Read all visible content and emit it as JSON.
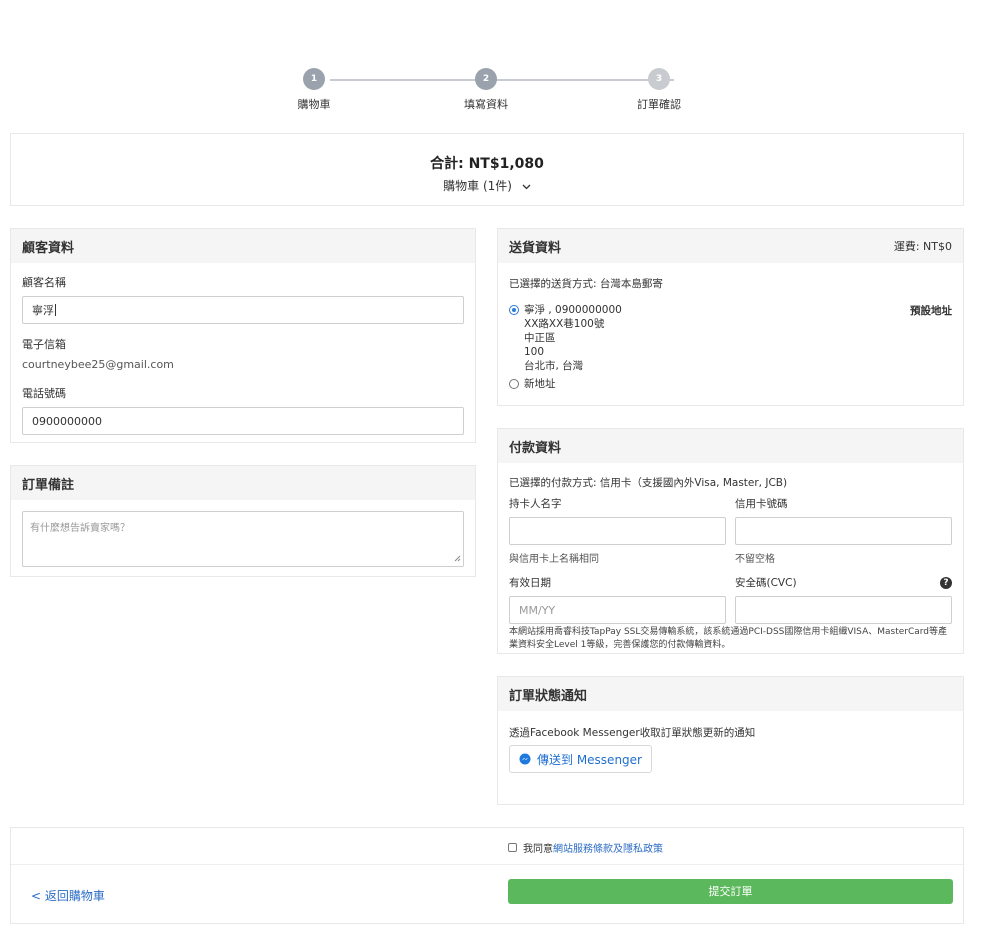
{
  "stepper": {
    "steps": [
      {
        "num": "1",
        "label": "購物車"
      },
      {
        "num": "2",
        "label": "填寫資料"
      },
      {
        "num": "3",
        "label": "訂單確認"
      }
    ]
  },
  "summary": {
    "total": "合計: NT$1,080",
    "cart": "購物車 (1件)",
    "chevron_icon": "chevron-down-icon"
  },
  "customer": {
    "title": "顧客資料",
    "name_label": "顧客名稱",
    "name_value": "寧浮",
    "email_label": "電子信箱",
    "email_value": "courtneybee25@gmail.com",
    "phone_label": "電話號碼",
    "phone_value": "0900000000"
  },
  "notes": {
    "title": "訂單備註",
    "placeholder": "有什麼想告訴賣家嗎？"
  },
  "shipping": {
    "title": "送貨資料",
    "fee": "運費: NT$0",
    "method": "已選擇的送貨方式: 台灣本島郵寄",
    "default_label": "預設地址",
    "address_lines": [
      "寧淨 , 0900000000",
      "XX路XX巷100號",
      "中正區",
      "100",
      "台北市, 台灣"
    ],
    "new_address": "新地址"
  },
  "payment": {
    "title": "付款資料",
    "method": "已選擇的付款方式: 信用卡（支援國內外Visa, Master, JCB)",
    "holder_label": "持卡人名字",
    "holder_hint": "與信用卡上名稱相同",
    "card_label": "信用卡號碼",
    "card_hint": "不留空格",
    "expiry_label": "有效日期",
    "expiry_placeholder": "MM/YY",
    "cvc_label": "安全碼(CVC)",
    "security_note": "本網站採用喬睿科技TapPay SSL交易傳輸系統，該系統通過PCI-DSS國際信用卡組織VISA、MasterCard等產業資料安全Level 1等級，完善保護您的付款傳輸資料。"
  },
  "notify": {
    "title": "訂單狀態通知",
    "desc": "透過Facebook Messenger收取訂單狀態更新的通知",
    "button": "傳送到 Messenger",
    "colors": {
      "link": "#1f6fd1"
    }
  },
  "footer": {
    "agree_prefix": "我同意",
    "agree_link": "網站服務條款及隱私政策",
    "back": "< 返回購物車",
    "submit": "提交訂單",
    "colors": {
      "submit": "#5cb85c",
      "link": "#2b6cc4"
    }
  }
}
